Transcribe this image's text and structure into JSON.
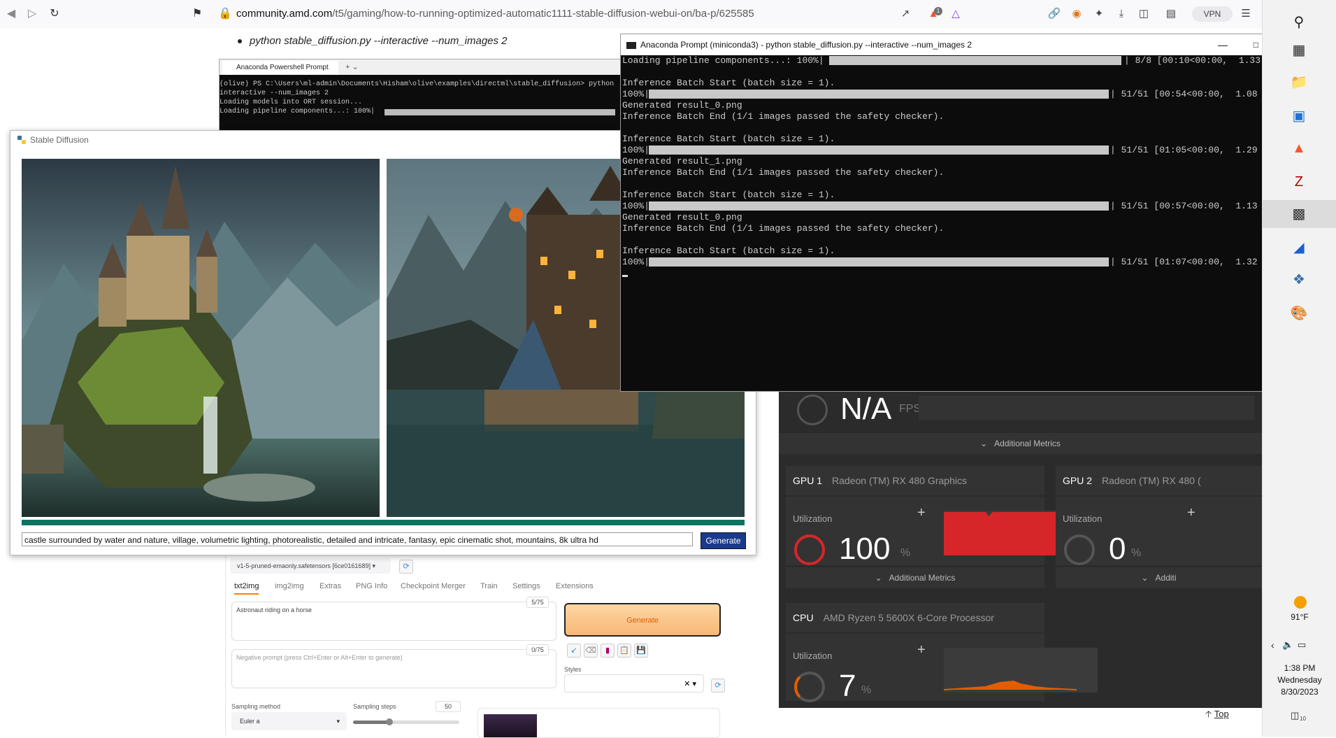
{
  "browser": {
    "url_host": "community.amd.com",
    "url_path": "/t5/gaming/how-to-running-optimized-automatic1111-stable-diffusion-webui-on/ba-p/625585",
    "vpn_label": "VPN",
    "shields_badge": "1"
  },
  "article": {
    "bullet": "python stable_diffusion.py --interactive --num_images 2",
    "top_page_link": "Top"
  },
  "powershell": {
    "tab_label": "Anaconda Powershell Prompt",
    "lines": [
      "(olive) PS C:\\Users\\ml-admin\\Documents\\Hisham\\olive\\examples\\directml\\stable_diffusion> python",
      "interactive --num_images 2",
      "Loading models into ORT session...",
      "Loading pipeline components...: 100%|"
    ]
  },
  "sd_window": {
    "title": "Stable Diffusion",
    "prompt": "castle surrounded by water and nature, village, volumetric lighting, photorealistic, detailed and intricate, fantasy, epic cinematic shot, mountains, 8k ultra hd",
    "generate_label": "Generate"
  },
  "webui": {
    "checkpoint": "v1-5-pruned-emaonly.safetensors [6ce0161689]",
    "tabs": [
      "txt2img",
      "img2img",
      "Extras",
      "PNG Info",
      "Checkpoint Merger",
      "Train",
      "Settings",
      "Extensions"
    ],
    "prompt": "Astronaut riding on a horse",
    "prompt_count": "5/75",
    "negative_placeholder": "Negative prompt (press Ctrl+Enter or Alt+Enter to generate)",
    "negative_count": "0/75",
    "generate_label": "Generate",
    "styles_label": "Styles",
    "sampling_method_label": "Sampling method",
    "sampling_method_value": "Euler a",
    "sampling_steps_label": "Sampling steps",
    "sampling_steps_value": "50",
    "sampling_steps_fraction": 0.34
  },
  "conda": {
    "title": "Anaconda Prompt (miniconda3) - python  stable_diffusion.py --interactive --num_images 2",
    "lines": {
      "l0": "Loading pipeline components...: 100%|",
      "l0r": "| 8/8 [00:10<00:00,  1.33",
      "l1": "Inference Batch Start (batch size = 1).",
      "l2": "100%|",
      "l2r": "| 51/51 [00:54<00:00,  1.08",
      "l3": "Generated result_0.png",
      "l4": "Inference Batch End (1/1 images passed the safety checker).",
      "l5": "Inference Batch Start (batch size = 1).",
      "l6": "100%|",
      "l6r": "| 51/51 [01:05<00:00,  1.29",
      "l7": "Generated result_1.png",
      "l8": "Inference Batch End (1/1 images passed the safety checker).",
      "l9": "Inference Batch Start (batch size = 1).",
      "l10": "100%|",
      "l10r": "| 51/51 [00:57<00:00,  1.13",
      "l11": "Generated result_0.png",
      "l12": "Inference Batch End (1/1 images passed the safety checker).",
      "l13": "Inference Batch Start (batch size = 1).",
      "l14": "100%|",
      "l14r": "| 51/51 [01:07<00:00,  1.32"
    }
  },
  "metrics": {
    "fps_value": "N/A",
    "fps_unit": "FPS",
    "additional_metrics": "Additional Metrics",
    "gpu1": {
      "label": "GPU 1",
      "name": "Radeon (TM) RX 480 Graphics",
      "util_label": "Utilization",
      "value": "100",
      "unit": "%"
    },
    "gpu2": {
      "label": "GPU 2",
      "name": "Radeon (TM) RX 480 (",
      "util_label": "Utilization",
      "value": "0",
      "unit": "%"
    },
    "gpu2_additional": "Additi",
    "cpu": {
      "label": "CPU",
      "name": "AMD Ryzen 5 5600X 6-Core Processor",
      "util_label": "Utilization",
      "value": "7",
      "unit": "%"
    }
  },
  "taskbar": {
    "temperature": "91°F",
    "time": "1:38 PM",
    "day": "Wednesday",
    "date": "8/30/2023",
    "notifications": "10"
  },
  "colors": {
    "accent_red": "#d7262a",
    "cpu_orange": "#e35d00",
    "sd_progress": "#0e7361",
    "webui_accent": "#ff7c00"
  }
}
